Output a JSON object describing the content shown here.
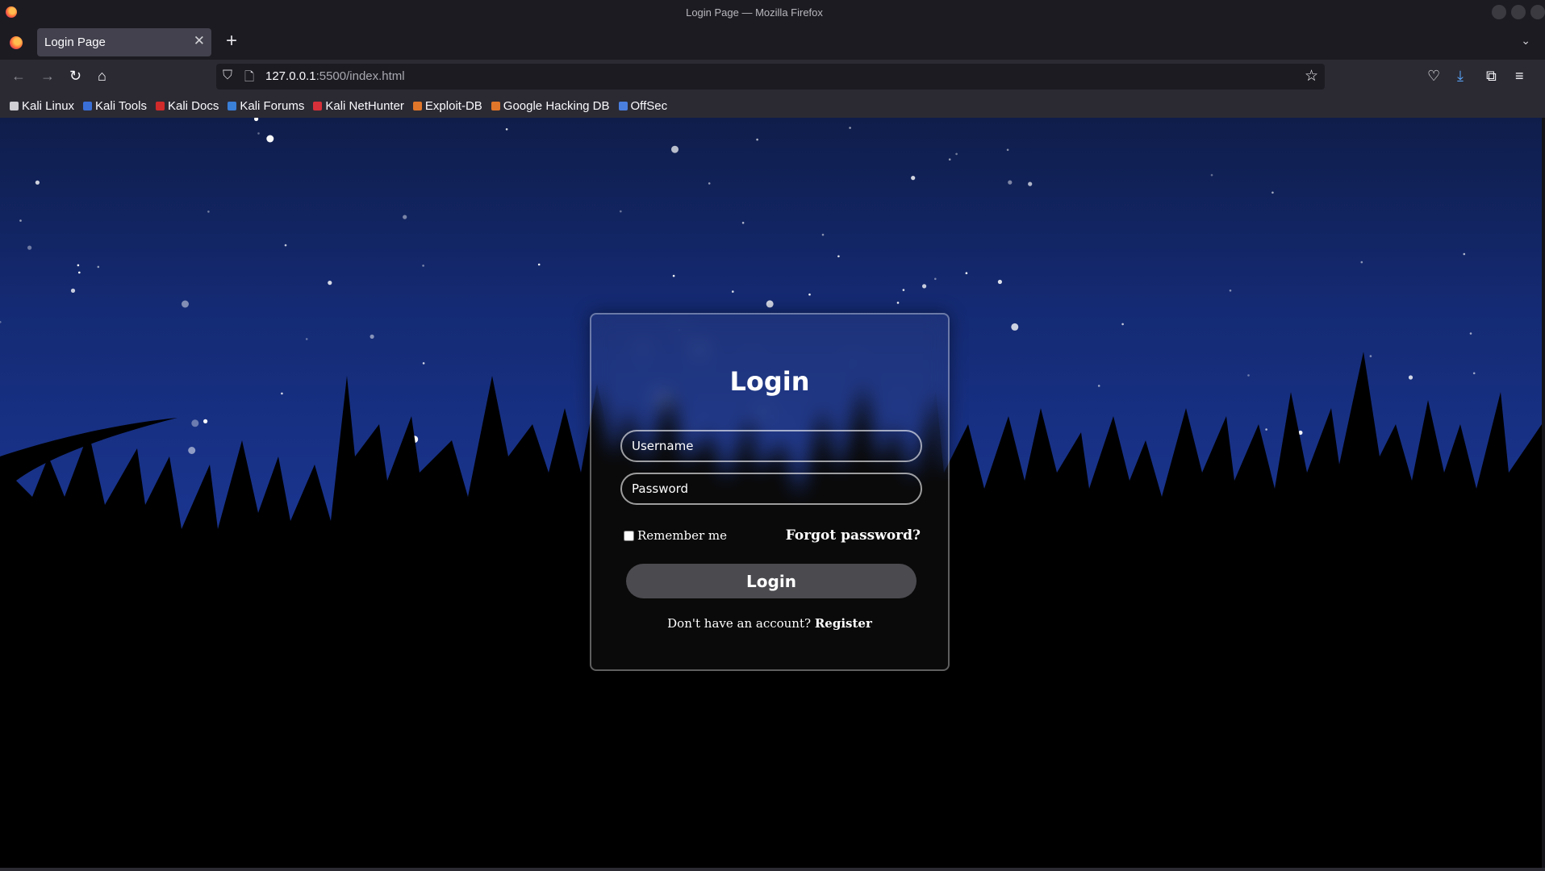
{
  "window": {
    "title": "Login Page — Mozilla Firefox"
  },
  "tab": {
    "label": "Login Page"
  },
  "address_bar": {
    "host": "127.0.0.1",
    "path": ":5500/index.html"
  },
  "bookmarks": [
    {
      "label": "Kali Linux",
      "icon": "kali-dragon-icon",
      "color": "#cfcfd4"
    },
    {
      "label": "Kali Tools",
      "icon": "kali-tools-icon",
      "color": "#3a6fd8"
    },
    {
      "label": "Kali Docs",
      "icon": "kali-docs-icon",
      "color": "#d02a2a"
    },
    {
      "label": "Kali Forums",
      "icon": "kali-forums-icon",
      "color": "#3a7fd8"
    },
    {
      "label": "Kali NetHunter",
      "icon": "nethunter-icon",
      "color": "#d8303a"
    },
    {
      "label": "Exploit-DB",
      "icon": "exploit-db-icon",
      "color": "#e0762a"
    },
    {
      "label": "Google Hacking DB",
      "icon": "ghdb-icon",
      "color": "#e0762a"
    },
    {
      "label": "OffSec",
      "icon": "offsec-icon",
      "color": "#4a7fe0"
    }
  ],
  "login": {
    "title": "Login",
    "username_placeholder": "Username",
    "username_value": "",
    "password_placeholder": "Password",
    "password_value": "",
    "remember_label": "Remember me",
    "remember_checked": false,
    "forgot_label": "Forgot password?",
    "button_label": "Login",
    "register_prompt": "Don't have an account?",
    "register_label": "Register"
  },
  "colors": {
    "sky_top": "#0f1d4a",
    "sky_mid": "#1d3b9c",
    "grass": "#000000",
    "button_bg": "#4a4a4f",
    "chrome_dark": "#1c1b22",
    "chrome_toolbar": "#2b2a33"
  }
}
